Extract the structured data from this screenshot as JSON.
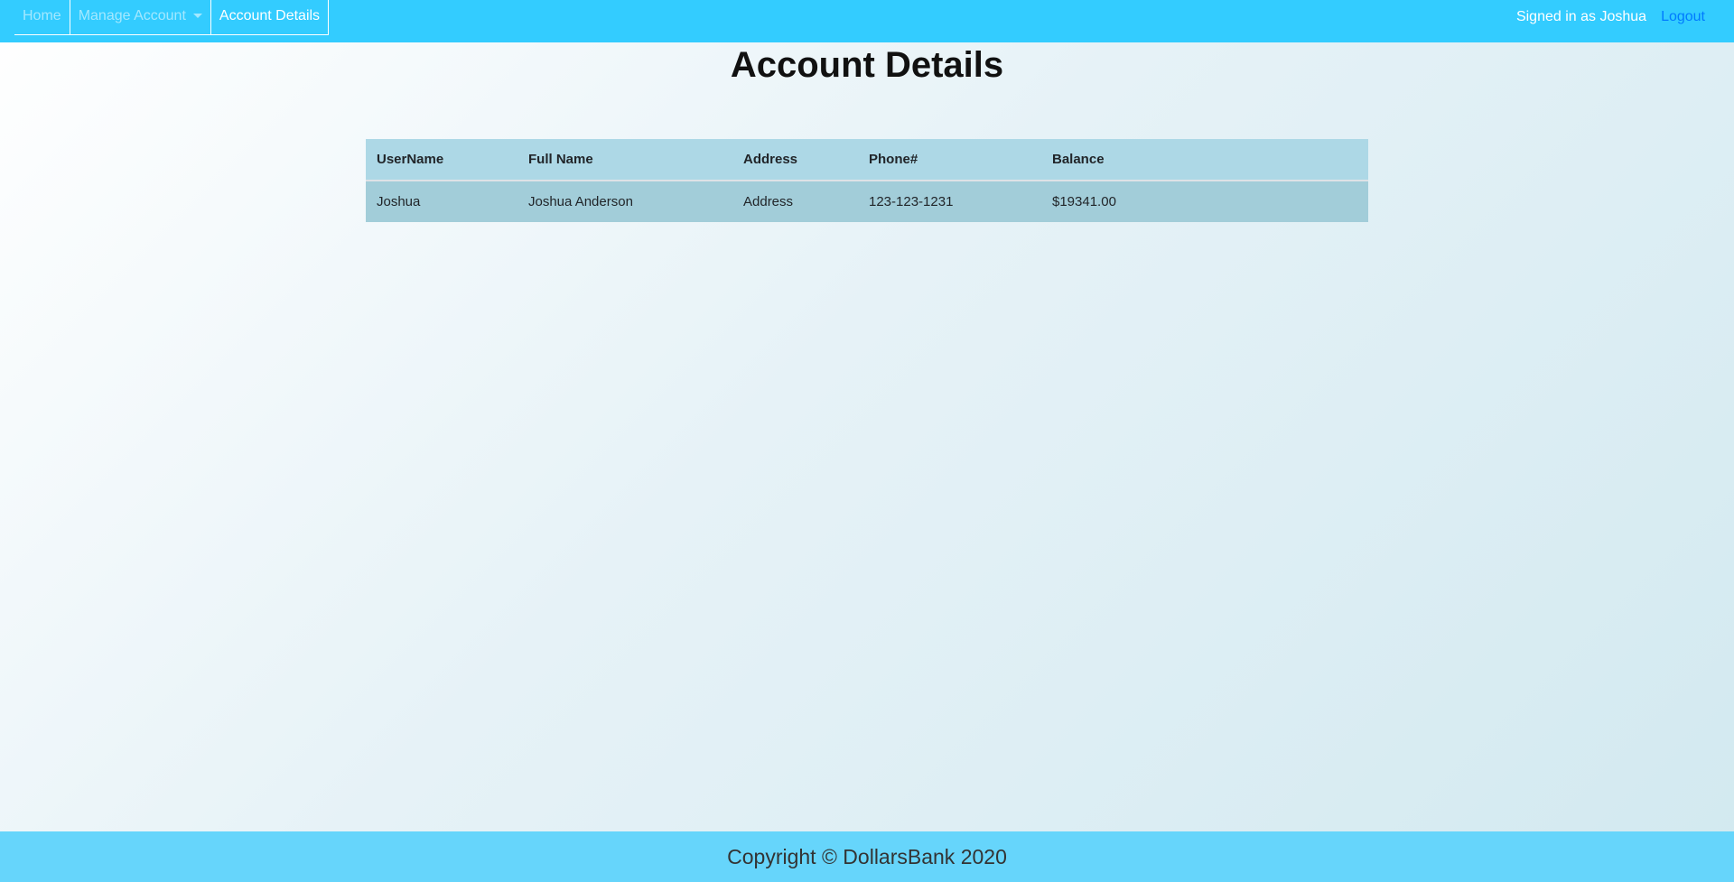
{
  "nav": {
    "home": "Home",
    "manage": "Manage Account",
    "details": "Account Details",
    "signed_in": "Signed in as Joshua",
    "logout": "Logout"
  },
  "page": {
    "title": "Account Details"
  },
  "table": {
    "headers": [
      "UserName",
      "Full Name",
      "Address",
      "Phone#",
      "Balance"
    ],
    "rows": [
      [
        "Joshua",
        "Joshua Anderson",
        "Address",
        "123-123-1231",
        "$19341.00"
      ]
    ]
  },
  "footer": {
    "text": "Copyright © DollarsBank 2020"
  }
}
